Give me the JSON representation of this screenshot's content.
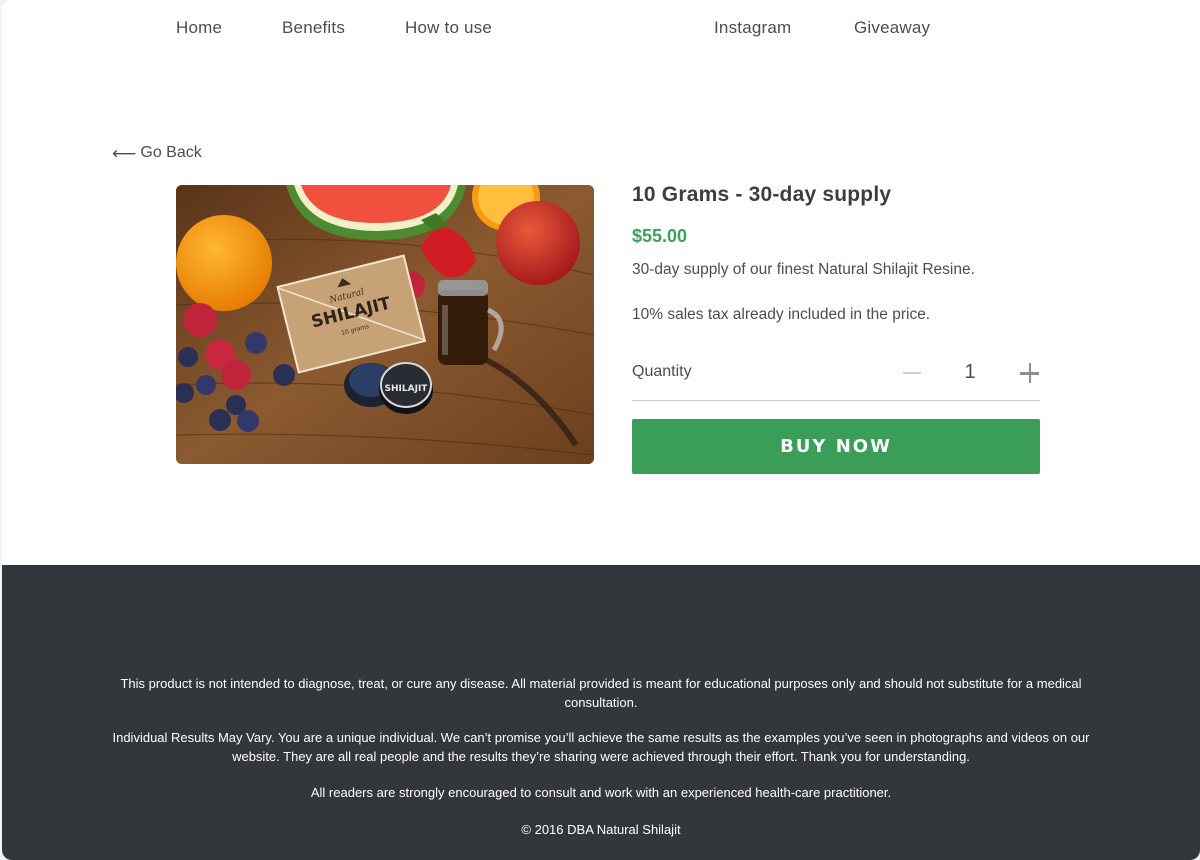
{
  "nav": {
    "items": [
      {
        "label": "Home"
      },
      {
        "label": "Benefits"
      },
      {
        "label": "How to use"
      },
      {
        "label": "Instagram"
      },
      {
        "label": "Giveaway"
      }
    ]
  },
  "back": {
    "arrow": "⟵",
    "label": "Go Back"
  },
  "product": {
    "image": {
      "alt": "Natural Shilajit box with jar and fruits on wooden table",
      "box_brand_script": "Natural",
      "box_brand": "SHILAJIT",
      "box_weight": "10 grams",
      "tin_label": "SHILAJIT"
    },
    "title": "10 Grams - 30-day supply",
    "price": "$55.00",
    "description": "30-day supply of our finest Natural Shilajit Resine.",
    "tax_note": "10% sales tax already included in the price.",
    "quantity": {
      "label": "Quantity",
      "value": "1"
    },
    "buy_label": "BUY NOW"
  },
  "footer": {
    "disclaimer": "This product is not intended to diagnose, treat, or cure any disease. All material provided is meant for educational purposes only and should not substitute for a medical consultation.",
    "results": "Individual Results May Vary. You are a unique individual. We can’t promise you’ll achieve the same results as the examples you’ve seen in photographs and videos on our website. They are all real people and the results they’re sharing were achieved through their effort. Thank you for understanding.",
    "advice": "All readers are strongly encouraged to consult and work with an experienced health-care practitioner.",
    "copyright": "© 2016 DBA Natural Shilajit"
  },
  "colors": {
    "accent_green": "#3a9d58",
    "price_green": "#3aa35a",
    "footer_bg": "#33363b",
    "text": "#3a3d42"
  }
}
